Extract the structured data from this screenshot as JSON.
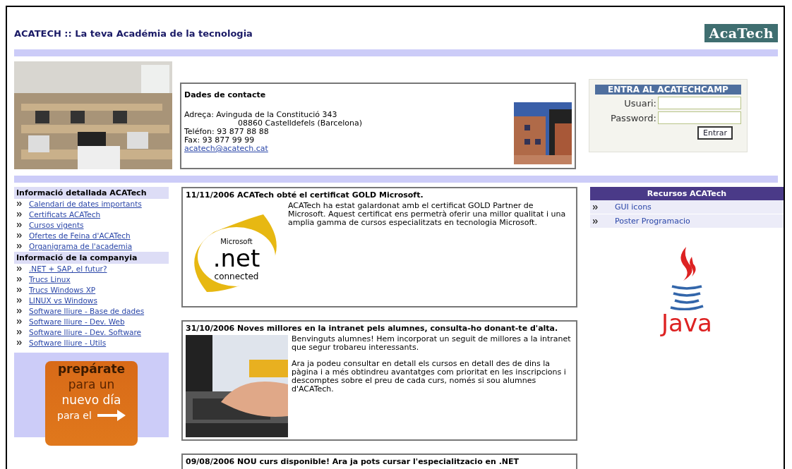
{
  "header": {
    "title": "ACATECH :: La teva Académia de la tecnologia",
    "logo": "AcaTech"
  },
  "contact": {
    "heading": "Dades de contacte",
    "address": "Adreça: Avinguda de la Constitució 343",
    "address_2": "08860 Castelldefels (Barcelona)",
    "phone": "Teléfon: 93 877 88 88",
    "fax": "Fax: 93 877 99 99",
    "email": "acatech@acatech.cat"
  },
  "login": {
    "title": "ENTRA AL ACATECHCAMP",
    "fields": [
      {
        "label": "Usuari:"
      },
      {
        "label": "Password:"
      }
    ],
    "button": "Entrar"
  },
  "sidebar": {
    "sections": [
      {
        "heading": "Informació detallada ACATech",
        "items": [
          "Calendari de dates importants",
          "Certificats ACATech",
          "Cursos vigents",
          "Ofertes de Feina d'ACATech",
          "Organigrama de l'academia"
        ]
      },
      {
        "heading": "Informació de la companyia",
        "items": [
          ".NET + SAP, el futur?",
          "Trucs Linux",
          "Trucs Windows XP",
          "LINUX vs Windows",
          "Software lliure - Base de dades",
          "Software lliure - Dev. Web",
          "Software lliure - Dev. Software",
          "Software lliure - Utils"
        ]
      }
    ]
  },
  "banner": {
    "lines": [
      "prepárate",
      "para un",
      "nuevo día",
      "para el"
    ]
  },
  "news": [
    {
      "title": "11/11/2006 ACATech obté el certificat GOLD Microsoft.",
      "image": {
        "kind": "badge",
        "lines": [
          "Microsoft",
          ".net",
          "connected"
        ]
      },
      "paragraphs": [
        "ACATech ha estat galardonat amb el certificat GOLD Partner de Microsoft. Aquest certificat ens permetrà oferir una millor qualitat i una amplia gamma de cursos especialitzats en tecnologia Microsoft."
      ]
    },
    {
      "title": "31/10/2006 Noves millores en la intranet pels alumnes, consulta-ho donant-te d'alta.",
      "image": {
        "kind": "picture"
      },
      "paragraphs": [
        "Benvinguts alumnes! Hem incorporat un seguit de millores a la intranet que segur trobareu interessants.",
        "Ara ja podeu consultar en detall els cursos en detall des de dins la pàgina i a més obtindreu avantatges com prioritat en les inscripcions i descomptes sobre el preu de cada curs, només si sou alumnes d'ACATech."
      ]
    },
    {
      "title": "09/08/2006 NOU curs disponible! Ara ja pots cursar l'especialitzacio en .NET"
    }
  ],
  "resources": {
    "title": "Recursos ACATech",
    "items": [
      "GUI icons",
      "Poster Programacio"
    ],
    "logo_text": "Java"
  }
}
